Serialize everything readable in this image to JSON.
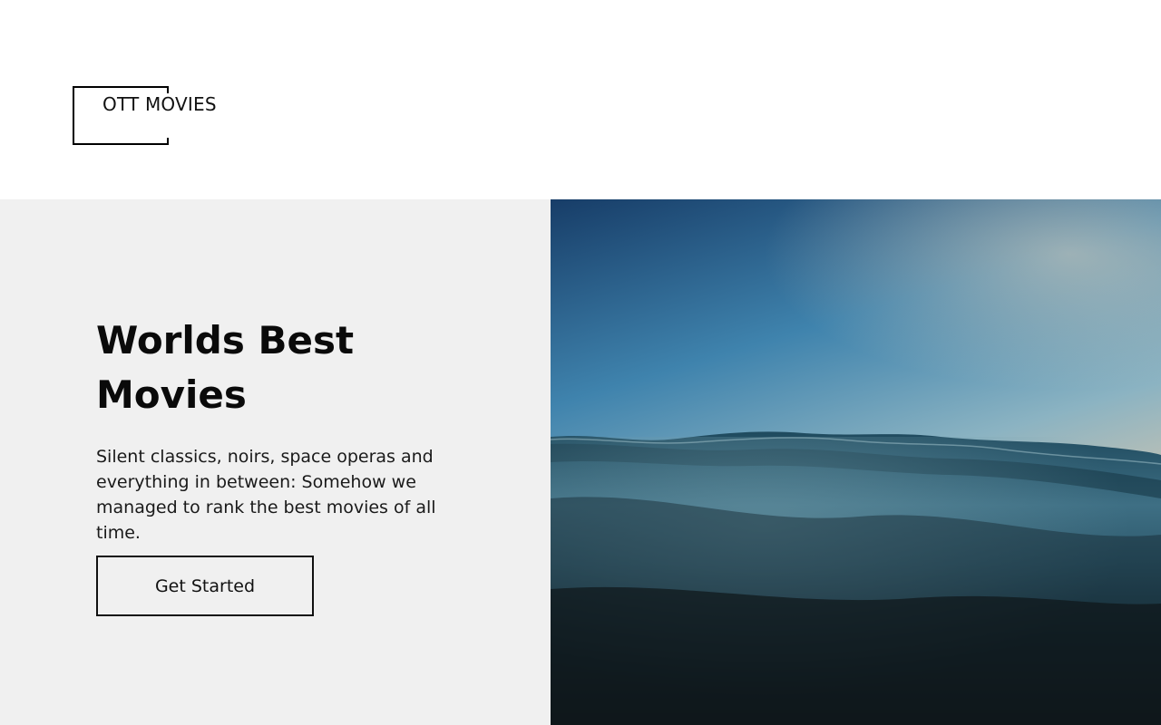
{
  "header": {
    "logo_text": "OTT MOVIES"
  },
  "hero": {
    "title_line1": "Worlds Best",
    "title_line2": "Movies",
    "description": "Silent classics, noirs, space operas and everything in between: Somehow we managed to rank the best movies of all time.",
    "cta_label": "Get Started",
    "image_subject": "ocean-waves-at-dusk"
  },
  "colors": {
    "page_bg": "#ffffff",
    "hero_left_bg": "#f0f0f0",
    "text": "#0a0a0a",
    "sky_top": "#1c4a78",
    "sky_mid": "#4f93b4",
    "horizon": "#d2c3ad",
    "water_dark": "#111619"
  }
}
